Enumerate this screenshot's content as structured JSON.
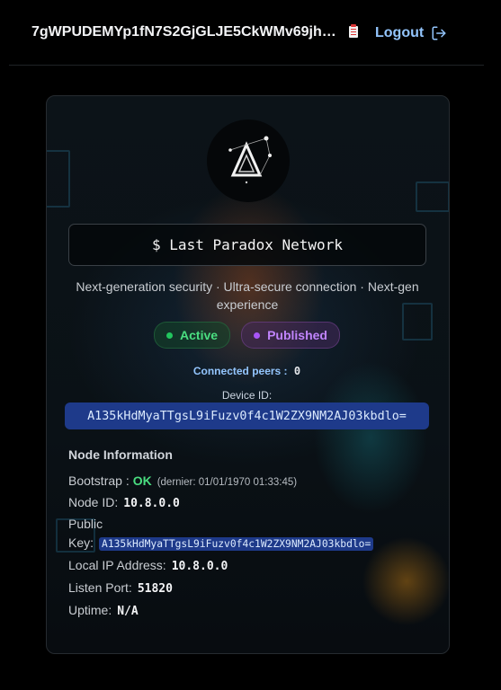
{
  "header": {
    "user_id": "7gWPUDEMYp1fN7S2GjGLJE5CkWMv69jhi...",
    "logout_label": "Logout"
  },
  "card": {
    "terminal_text": "$ Last Paradox Network",
    "tagline": "Next-generation security · Ultra-secure connection · Next-gen experience",
    "badges": [
      {
        "label": "Active",
        "color": "#4ade80"
      },
      {
        "label": "Published",
        "color": "#c084fc"
      }
    ],
    "connected_peers_label": "Connected peers :",
    "connected_peers_value": "0",
    "device_id_label": "Device ID:",
    "device_id": "A135kHdMyaTTgsL9iFuzv0f4c1W2ZX9NM2AJ03kbdlo="
  },
  "node_info": {
    "title": "Node Information",
    "bootstrap_label": "Bootstrap :",
    "bootstrap_status": "OK",
    "bootstrap_detail": "(dernier: 01/01/1970 01:33:45)",
    "node_id_label": "Node ID:",
    "node_id": "10.8.0.0",
    "public_key_label_1": "Public",
    "public_key_label_2": "Key:",
    "public_key": "A135kHdMyaTTgsL9iFuzv0f4c1W2ZX9NM2AJ03kbdlo=",
    "local_ip_label": "Local IP Address:",
    "local_ip": "10.8.0.0",
    "listen_port_label": "Listen Port:",
    "listen_port": "51820",
    "uptime_label": "Uptime:",
    "uptime": "N/A"
  },
  "icons": {
    "copy": "clipboard-icon",
    "logout": "logout-arrow-icon",
    "logo": "triangle-network-logo"
  }
}
